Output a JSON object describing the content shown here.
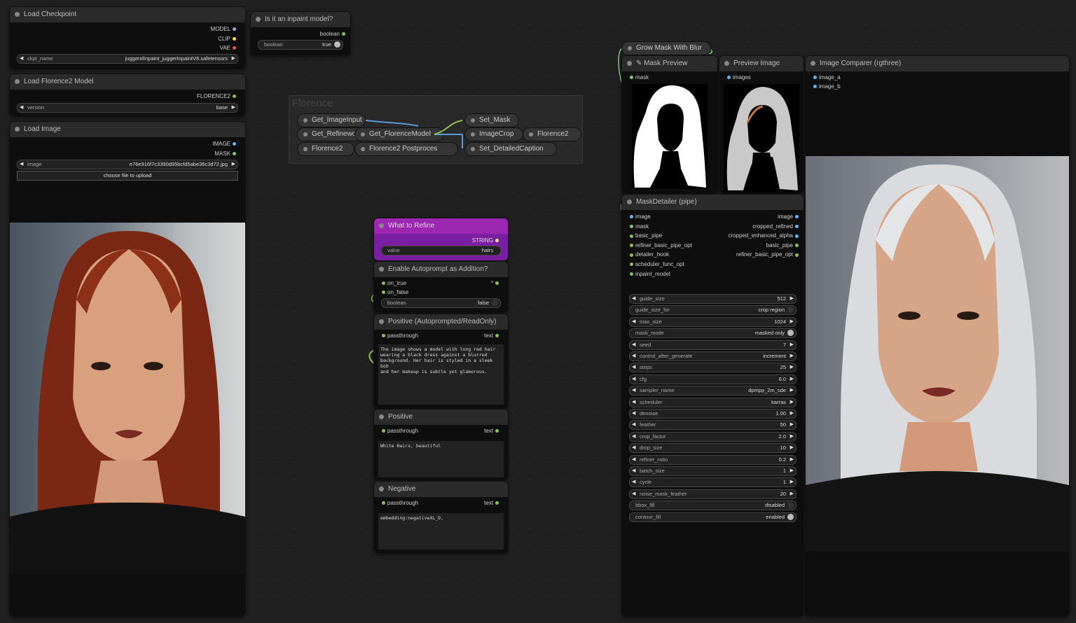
{
  "colors": {
    "model": "#b39ddb",
    "clip": "#ffd54f",
    "vae": "#ef5350",
    "image": "#64b5f6",
    "mask": "#81c784",
    "green": "#8bc34a",
    "purple": "#8e24aa"
  },
  "load_checkpoint": {
    "title": "Load Checkpoint",
    "out_model": "MODEL",
    "out_clip": "CLIP",
    "out_vae": "VAE",
    "ckpt_label": "ckpt_name",
    "ckpt_value": "juggerxlInpaint_juggerInpaintV8.safetensors"
  },
  "inpaint_q": {
    "title": "Is it an inpaint model?",
    "out": "boolean",
    "w_label": "boolean",
    "w_value": "true"
  },
  "florence_model": {
    "title": "Load Florence2 Model",
    "out": "FLORENCE2",
    "w_label": "version",
    "w_value": "base"
  },
  "load_image": {
    "title": "Load Image",
    "out_image": "IMAGE",
    "out_mask": "MASK",
    "w_label": "image",
    "w_value": "e76e916f7c3390d95bcfd5abe36c3d72.jpg",
    "upload": "choose file to upload"
  },
  "florence_group": {
    "title": "Florence",
    "nodes": [
      "Get_ImageInput",
      "Get_Refinewo",
      "Get_FlorenceModel",
      "Florence2",
      "Florence2 Postproces",
      "Set_Mask",
      "ImageCrop",
      "Florence2",
      "Set_DetailedCaption"
    ]
  },
  "what_refine": {
    "title": "What to Refine",
    "out": "STRING",
    "w_label": "value",
    "w_value": "hairs"
  },
  "autoprompt": {
    "title": "Enable Autoprompt as Addition?",
    "in_true": "on_true",
    "in_false": "on_false",
    "out": "*",
    "w_label": "boolean",
    "w_value": "false"
  },
  "positive_auto": {
    "title": "Positive (Autoprompted/ReadOnly)",
    "in": "passthrough",
    "out": "text",
    "text": "The image shows a model with long red hair\nwearing a black dress against a blurred\nbackground. Her hair is styled in a sleek bob\nand her makeup is subtle yet glamorous."
  },
  "positive": {
    "title": "Positive",
    "in": "passthrough",
    "out": "text",
    "text": "White Hairs, beautiful"
  },
  "negative": {
    "title": "Negative",
    "in": "passthrough",
    "out": "text",
    "text": "embedding:negativeXL_D,"
  },
  "grow_mask": {
    "title": "Grow Mask With Blur"
  },
  "mask_preview": {
    "title": "Mask Preview",
    "in": "mask"
  },
  "preview_image": {
    "title": "Preview Image",
    "in": "images"
  },
  "comparer": {
    "title": "Image Comparer (rgthree)",
    "in_a": "image_a",
    "in_b": "image_b"
  },
  "mask_detailer": {
    "title": "MaskDetailer (pipe)",
    "inputs": [
      "image",
      "mask",
      "basic_pipe",
      "refiner_basic_pipe_opt",
      "detailer_hook",
      "scheduler_func_opt",
      "inpaint_model"
    ],
    "outputs": [
      "image",
      "cropped_refined",
      "cropped_enhanced_alpha",
      "basic_pipe",
      "refiner_basic_pipe_opt"
    ],
    "widgets": [
      {
        "label": "guide_size",
        "value": "512",
        "type": "num"
      },
      {
        "label": "guide_size_for",
        "value": "crop region",
        "type": "tog"
      },
      {
        "label": "max_size",
        "value": "1024",
        "type": "num"
      },
      {
        "label": "mask_mode",
        "value": "masked only",
        "type": "tog"
      },
      {
        "label": "seed",
        "value": "7",
        "type": "num"
      },
      {
        "label": "control_after_generate",
        "value": "increment",
        "type": "num"
      },
      {
        "label": "steps",
        "value": "25",
        "type": "num"
      },
      {
        "label": "cfg",
        "value": "6.0",
        "type": "num"
      },
      {
        "label": "sampler_name",
        "value": "dpmpp_2m_sde",
        "type": "num"
      },
      {
        "label": "scheduler",
        "value": "karras",
        "type": "num"
      },
      {
        "label": "denoise",
        "value": "1.00",
        "type": "num"
      },
      {
        "label": "feather",
        "value": "50",
        "type": "num"
      },
      {
        "label": "crop_factor",
        "value": "2.0",
        "type": "num"
      },
      {
        "label": "drop_size",
        "value": "10",
        "type": "num"
      },
      {
        "label": "refiner_ratio",
        "value": "0.2",
        "type": "num"
      },
      {
        "label": "batch_size",
        "value": "1",
        "type": "num"
      },
      {
        "label": "cycle",
        "value": "1",
        "type": "num"
      },
      {
        "label": "noise_mask_feather",
        "value": "20",
        "type": "num"
      },
      {
        "label": "bbox_fill",
        "value": "disabled",
        "type": "tog"
      },
      {
        "label": "contour_fill",
        "value": "enabled",
        "type": "tog"
      }
    ]
  }
}
